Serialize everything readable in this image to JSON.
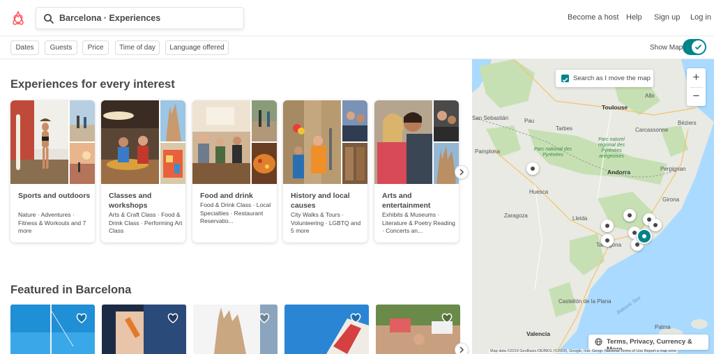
{
  "header": {
    "search_text": "Barcelona · Experiences",
    "nav": [
      "Become a host",
      "Help",
      "Sign up",
      "Log in"
    ]
  },
  "filters": {
    "chips": [
      "Dates",
      "Guests",
      "Price",
      "Time of day",
      "Language offered"
    ],
    "show_map_label": "Show Map",
    "show_map_on": true
  },
  "main": {
    "interest_title": "Experiences for every interest",
    "categories": [
      {
        "title": "Sports and outdoors",
        "desc": "Nature · Adventures · Fitness & Workouts and 7 more"
      },
      {
        "title": "Classes and workshops",
        "desc": "Arts & Craft Class · Food & Drink Class · Performing Art Class"
      },
      {
        "title": "Food and drink",
        "desc": "Food & Drink Class · Local Specialties · Restaurant Reservatio..."
      },
      {
        "title": "History and local causes",
        "desc": "City Walks & Tours · Volunteering · LGBTQ and 5 more"
      },
      {
        "title": "Arts and entertainment",
        "desc": "Exhibits & Museums · Literature & Poetry Reading · Concerts an..."
      }
    ],
    "featured_title": "Featured in Barcelona"
  },
  "map": {
    "search_as_move": "Search as I move the map",
    "zoom_in": "+",
    "zoom_out": "−",
    "terms": "Terms, Privacy, Currency & More",
    "attribution": "Map data ©2019 GeoBasis-DE/BKG (©2009), Google, Inst. Geogr. Nacional   Terms of Use   Report a map error",
    "places": {
      "toulouse": "Toulouse",
      "andorra": "Andorra",
      "perpignan": "Perpignan",
      "pamplona": "Pamplona",
      "huesca": "Huesca",
      "zaragoza": "Zaragoza",
      "lleida": "Lleida",
      "girona": "Girona",
      "tarragona": "Tarragona",
      "castellon": "Castellón de la Plana",
      "valencia": "Valencia",
      "palma": "Palma",
      "albi": "Albi",
      "beziers": "Béziers",
      "sansebastian": "San Sebastián",
      "tarbes": "Tarbes",
      "carcassonne": "Carcassonne",
      "pau": "Pau",
      "balearic": "Balearic Sea",
      "parc1": "Parc national des Pyrénées",
      "parc2": "Parc naturel régional des Pyrénées ariégeoises"
    },
    "colors": {
      "land": "#e4e7e0",
      "forest": "#c6e0b4",
      "water": "#aadaff",
      "accent": "#00848a"
    }
  },
  "icons": {
    "logo": "airbnb-logo-icon",
    "search": "search-icon",
    "check": "check-icon",
    "heart": "heart-icon",
    "globe": "globe-icon",
    "chevron": "chevron-right-icon"
  }
}
